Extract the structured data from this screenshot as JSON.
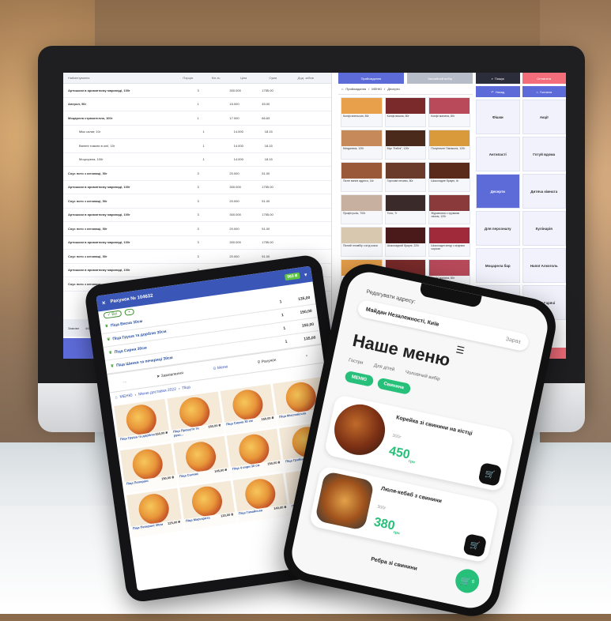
{
  "desktop": {
    "order_columns": [
      "Найменування",
      "Порція",
      "Кіл-ть",
      "Ціна",
      "Сума",
      "Дод. зобов"
    ],
    "order_rows": [
      {
        "name": "Артишоки в ароматному маринаді, 100г",
        "qty": "3",
        "price": "300.000",
        "sum": "1755.00",
        "sub": false
      },
      {
        "name": "Аперол, 50г",
        "qty": "1",
        "price": "15.000",
        "sum": "45.00",
        "sub": false
      },
      {
        "name": "Моцарела страчателла, 100г",
        "qty": "1",
        "price": "17.000",
        "sum": "66.83",
        "sub": false
      },
      {
        "name": "Мікс салат, 10г",
        "qty": "1",
        "price": "14.000",
        "sum": "18.15",
        "sub": true
      },
      {
        "name": "Вяленi томати в олії, 10г",
        "qty": "1",
        "price": "14.000",
        "sum": "18.15",
        "sub": true
      },
      {
        "name": "Моцгорела, 100г",
        "qty": "1",
        "price": "14.000",
        "sum": "18.15",
        "sub": true
      },
      {
        "name": "Соус пото з кеноваці, 50г",
        "qty": "3",
        "price": "20.000",
        "sum": "51.00",
        "sub": false
      },
      {
        "name": "Артишоки в ароматному маринаді, 100г",
        "qty": "3",
        "price": "300.000",
        "sum": "1755.00",
        "sub": false
      },
      {
        "name": "Соус пото з кеноваці, 50г",
        "qty": "3",
        "price": "20.000",
        "sum": "51.00",
        "sub": false
      },
      {
        "name": "Артишоки в ароматному маринаді, 100г",
        "qty": "3",
        "price": "300.000",
        "sum": "1755.00",
        "sub": false
      },
      {
        "name": "Соус пото з кеноваці, 50г",
        "qty": "3",
        "price": "20.000",
        "sum": "51.00",
        "sub": false
      },
      {
        "name": "Артишоки в ароматному маринаді, 100г",
        "qty": "3",
        "price": "300.000",
        "sum": "1755.00",
        "sub": false
      },
      {
        "name": "Соус пото з кеноваці, 50г",
        "qty": "3",
        "price": "20.000",
        "sum": "51.00",
        "sub": false
      },
      {
        "name": "Артишоки в ароматному маринаді, 100г",
        "qty": "3",
        "price": "300.000",
        "sum": "1755.00",
        "sub": false
      },
      {
        "name": "Соус пото з кеноваці",
        "qty": "",
        "price": "",
        "sum": "",
        "sub": false
      }
    ],
    "order_footer": {
      "label1": "Замовл",
      "value1": "4451",
      "label2": "Без оплати",
      "value2": ""
    },
    "menu_tabs": [
      "Прийомдання",
      "Звичайний вибір"
    ],
    "breadcrumb": [
      "Прийомдання",
      "МЕНЮ",
      "Десерти"
    ],
    "menu_tiles": [
      "Конфі апельсин, 80г",
      "Конфі вишня, 80г",
      "Конфі малина, 80г",
      "Мигдалвок, 120г",
      "Мус \"Бейлі\", 120г",
      "Полуничне Панакота, 120г",
      "Пісне ванілі адресо, 16г",
      "Горіхове печиво, 80г",
      "Шоколадне брауні, 6г",
      "Профітроль, 700г",
      "Тоно, 7г",
      "Журавлина з хрумким лахом, 120г",
      "Пісний пломбір з ягід кокос",
      "Шоколадний брауні, 220г",
      "Шоколадні кенді з ягідним соусом",
      "Конфі апельсин, 80г",
      "Конфі вишня, 80г",
      "Конфі малина, 80г"
    ],
    "search_label": "Пошук",
    "red_button": "Оплатити",
    "row2": [
      "Назад",
      "Головна"
    ],
    "categories": [
      "Фішки",
      "Акції",
      "Антипасті",
      "Готуй вдома",
      "Десерти",
      "Дитяча кімната",
      "Для персоналу",
      "Кулінарія",
      "Моцарела бар",
      "Напої Алкоголь",
      "Напої",
      "Напої Гарячі"
    ],
    "active_category": "Десерти"
  },
  "tablet": {
    "title": "Рахунок № 104632",
    "total": "983 ₴",
    "ok_label": "Всі",
    "lines": [
      {
        "name": "Піца Весна 30см",
        "qty": "1",
        "price": "135,00"
      },
      {
        "name": "Піца Груша та дорблю 30см",
        "qty": "1",
        "price": "150,00"
      },
      {
        "name": "Піца Сирна 30см",
        "qty": "1",
        "price": "150,00"
      },
      {
        "name": "Піца Шинка та печериці 30см",
        "qty": "1",
        "price": "135,00"
      }
    ],
    "nav": [
      "Замовлення",
      "Меню",
      "Рахунок"
    ],
    "active_nav": "Меню",
    "crumbs": [
      "МЕНЮ",
      "Меню доставки 2022",
      "Піца"
    ],
    "pizzas": [
      {
        "name": "Піца Груша та дорблю",
        "price": "150,00 ₴"
      },
      {
        "name": "Піца Прошуто та руко...",
        "price": "160,00 ₴"
      },
      {
        "name": "Піца Сирна 30 см",
        "price": "150,00 ₴"
      },
      {
        "name": "Піца Мисливська",
        "price": "150,00 ₴"
      },
      {
        "name": "Піца Пепероні",
        "price": "150,00 ₴"
      },
      {
        "name": "Піца Салямі",
        "price": "145,00 ₴"
      },
      {
        "name": "Піца 4 сири 30 см",
        "price": "150,00 ₴"
      },
      {
        "name": "Піца Грибна",
        "price": "140,00 ₴"
      },
      {
        "name": "Піца Пепероні 30см",
        "price": "125,00 ₴"
      },
      {
        "name": "Піца Маргарита",
        "price": "120,00 ₴"
      },
      {
        "name": "Піца Гавайська",
        "price": "140,00 ₴"
      },
      {
        "name": "Піца Овочева",
        "price": "130,00 ₴"
      }
    ]
  },
  "phone": {
    "address_label": "Редагувати адресу:",
    "address": "Майдан Незалежності, Київ",
    "now": "Зараз",
    "title": "Наше меню",
    "filters": [
      "Гостри",
      "Для дітей",
      "Чоловічий вибір"
    ],
    "chips": [
      "МЕНЮ",
      "Свинина"
    ],
    "items": [
      {
        "name": "Корейка зі свинини на кістці",
        "weight": "300г",
        "price": "450",
        "currency": "грн"
      },
      {
        "name": "Люля-кебаб з свинини",
        "weight": "300г",
        "price": "380",
        "currency": "грн"
      }
    ],
    "last_item": "Ребра зі свинини",
    "cart_count": "0"
  }
}
